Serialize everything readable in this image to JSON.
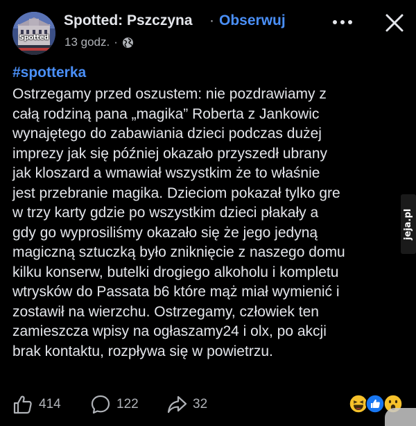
{
  "header": {
    "avatar_text": "Spotted",
    "page_name": "Spotted: Pszczyna",
    "separator": "·",
    "follow_label": "Obserwuj",
    "timestamp": "13 godz.",
    "meta_separator": "·",
    "audience_icon": "globe-icon",
    "more_icon": "more-horizontal-icon",
    "close_icon": "close-icon"
  },
  "post": {
    "hashtag": "#spotterka",
    "lines": [
      "Ostrzegamy przed oszustem: nie pozdrawiamy z",
      "całą rodziną pana „magika” Roberta z Jankowic",
      "wynajętego do zabawiania dzieci podczas dużej",
      "imprezy jak się później okazało przyszedł ubrany",
      "jak kloszard a wmawiał wszystkim że to właśnie",
      "jest przebranie magika. Dzieciom pokazał tylko gre",
      "w trzy karty gdzie po wszystkim dzieci płakały a",
      "gdy go wyprosiliśmy okazało się że  jego jedyną",
      "magiczną sztuczką było zniknięcie z naszego domu",
      "kilku konserw, butelki drogiego alkoholu i kompletu",
      "wtrysków do Passata b6 które mąż miał wymienić i",
      "zostawił na wierzchu. Ostrzegamy, człowiek ten",
      "zamieszcza wpisy na ogłaszamy24 i olx, po akcji",
      "brak kontaktu, rozpływa się w powietrzu."
    ]
  },
  "watermark": {
    "text": "jeja.pl"
  },
  "footer": {
    "like_icon": "thumbs-up-icon",
    "like_count": "414",
    "comment_icon": "comment-icon",
    "comment_count": "122",
    "share_icon": "share-icon",
    "share_count": "32",
    "reactions": [
      "haha-reaction-icon",
      "like-reaction-icon",
      "wow-reaction-icon"
    ]
  },
  "colors": {
    "background": "#000000",
    "text": "#e4e6eb",
    "secondary_text": "#b0b3b8",
    "link": "#4a8ff7",
    "like_blue": "#1877f2",
    "reaction_yellow": "#f7c22b"
  }
}
